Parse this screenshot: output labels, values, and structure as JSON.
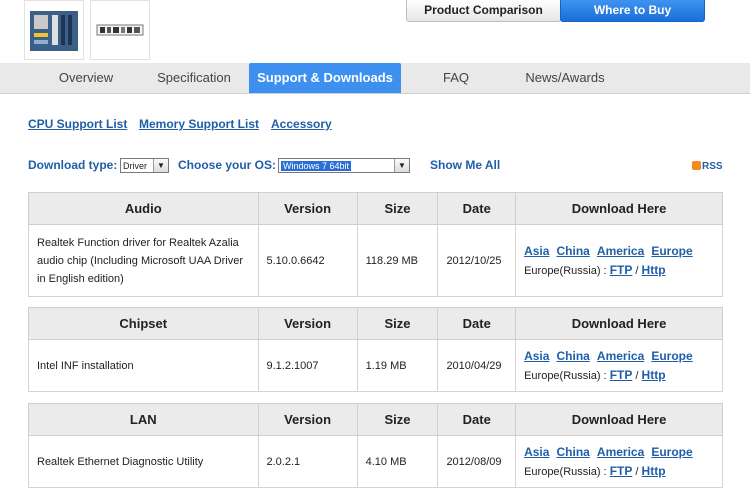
{
  "header": {
    "compare_button": "Product Comparison",
    "buy_button": "Where to Buy"
  },
  "tabs": [
    {
      "label": "Overview"
    },
    {
      "label": "Specification"
    },
    {
      "label": "Support & Downloads"
    },
    {
      "label": "FAQ"
    },
    {
      "label": "News/Awards"
    }
  ],
  "links": {
    "cpu": "CPU Support List",
    "memory": "Memory Support List",
    "accessory": "Accessory"
  },
  "filters": {
    "download_type_label": "Download type:",
    "download_type_value": "Driver",
    "os_label": "Choose your OS:",
    "os_value": "Windows 7 64bit",
    "show_all": "Show Me All",
    "rss": "RSS"
  },
  "columns": {
    "version": "Version",
    "size": "Size",
    "date": "Date",
    "download": "Download Here"
  },
  "mirrors": {
    "asia": "Asia",
    "china": "China",
    "america": "America",
    "europe": "Europe",
    "russia_label": "Europe(Russia) :",
    "ftp": "FTP",
    "sep": "/",
    "http": "Http"
  },
  "sections": [
    {
      "category": "Audio",
      "rows": [
        {
          "name": "Realtek Function driver for Realtek Azalia audio chip (Including Microsoft UAA Driver in English edition)",
          "version": "5.10.0.6642",
          "size": "118.29 MB",
          "date": "2012/10/25"
        }
      ]
    },
    {
      "category": "Chipset",
      "rows": [
        {
          "name": "Intel INF installation",
          "version": "9.1.2.1007",
          "size": "1.19 MB",
          "date": "2010/04/29"
        }
      ]
    },
    {
      "category": "LAN",
      "rows": [
        {
          "name": "Realtek Ethernet Diagnostic Utility",
          "version": "2.0.2.1",
          "size": "4.10 MB",
          "date": "2012/08/09"
        }
      ]
    }
  ]
}
